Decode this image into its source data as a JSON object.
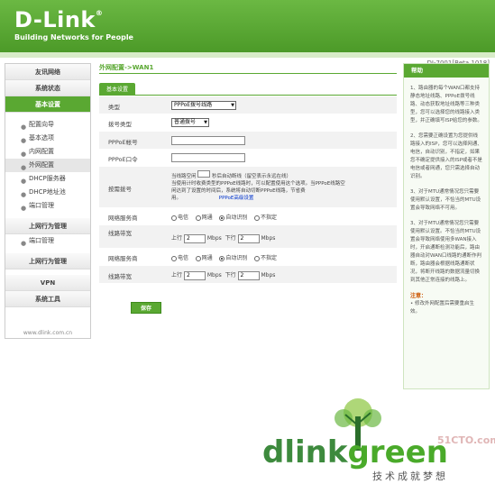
{
  "header": {
    "logo": "D-Link",
    "logo_mark": "®",
    "tagline": "Building Networks for People",
    "model": "DI-7001[Beta 1018]"
  },
  "sidebar": {
    "top_items": [
      {
        "label": "友讯网络"
      },
      {
        "label": "系统状态"
      },
      {
        "label": "基本设置"
      }
    ],
    "sub_items": [
      {
        "label": "配置向导"
      },
      {
        "label": "基本选项"
      },
      {
        "label": "内网配置"
      },
      {
        "label": "外网配置"
      },
      {
        "label": "DHCP服务器"
      },
      {
        "label": "DHCP地址池"
      },
      {
        "label": "端口管理"
      }
    ],
    "group1": {
      "label": "上网行为管理"
    },
    "group1_sub": {
      "label": "端口管理"
    },
    "group2": {
      "label": "上网行为管理"
    },
    "group3": {
      "label": "VPN"
    },
    "group4": {
      "label": "系统工具"
    },
    "footer": "www.dlink.com.cn"
  },
  "main": {
    "breadcrumb": "外网配置->WAN1",
    "tab": "基本设置",
    "rows": {
      "type_label": "类型",
      "type_value": "PPPoE拨号线路",
      "dial_label": "拨号类型",
      "dial_value": "普通拨号",
      "acct_label": "PPPoE帐号",
      "acct_value": "",
      "pwd_label": "PPPoE口令",
      "pwd_value": "",
      "ondemand_label": "按需拨号",
      "ondemand_line1a": "当线路空闲",
      "ondemand_idle": "",
      "ondemand_line1b": "秒后自动断线（留空表示永远在线）",
      "ondemand_line2": "当使用计时收费类型的PPPoE线路时，可以配置使用这个选项。当PPPoE线路空",
      "ondemand_line3": "闲达到了设置的时间后，系统将自动切断PPPoE线路，节省费",
      "ondemand_line4": "用。",
      "ondemand_link": "PPPoE高级设置",
      "isp_label": "网络服务商",
      "isp_options": [
        "电信",
        "网通",
        "自动识别",
        "不指定"
      ],
      "bw_label": "线路带宽",
      "bw_up_label": "上行",
      "bw_up": "2",
      "bw_unit": "Mbps",
      "bw_down_label": "下行",
      "bw_down": "2",
      "isp2_label": "网络服务商",
      "isp2_options": [
        "电信",
        "网通",
        "自动识别",
        "不指定"
      ],
      "bw2_label": "线路带宽",
      "bw2_up": "2",
      "bw2_down": "2"
    },
    "save": "保存"
  },
  "help": {
    "title": "帮助",
    "p1": "1、路由器的每个WAN口都支持静态地址线路、PPPoE拨号线路、动态获取地址线路等三种类型，您可以选择您的线路接入类型，并正确填写ISP给您的参数。",
    "p2": "2、您需要正确设置为您提供线路接入的ISP，您可以选择网通、电信，自动识别，不指定，如果您不确定提供接入的ISP或者不是电信或者网通，您只需选择自动识别。",
    "p3": "3、对于MTU通常情况您只需要使用默认设置，不恰当的MTU设置会导致网络不可用。",
    "p4": "3、对于MTU通常情况您只需要使用默认设置。不恰当的MTU设置会导致网络使用多WAN接入时，开启通断检测功能后，路由器自动对WAN口线路的通断作判断，路由器会根据线路通断状况，将断开线路的数据流量切换到其他正常连接的线路上。",
    "note_title": "注意：",
    "note": "• 修改外网配置后需要重启生效。"
  },
  "brand": {
    "dlink": "dlink",
    "green": "green",
    "slogan": "技术成就梦想",
    "watermark": "51CTO.com"
  },
  "colors": {
    "accent": "#5aa832",
    "link": "#0033cc"
  }
}
